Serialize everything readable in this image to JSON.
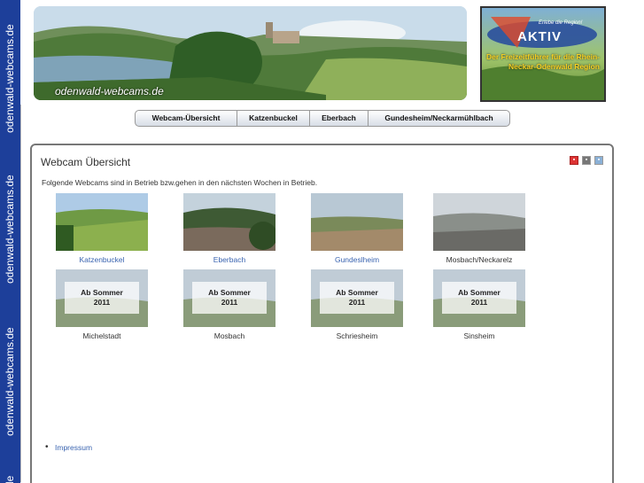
{
  "sidebar": {
    "text": "odenwald-webcams.de",
    "short": "de"
  },
  "banner": {
    "caption": "odenwald-webcams.de"
  },
  "ad": {
    "tagline": "Erlebe die Region!",
    "word": "AKTIV",
    "text": "Der Freizeitführer für die Rhein-Neckar-Odenwald Region"
  },
  "nav": [
    "Webcam-Übersicht",
    "Katzenbuckel",
    "Eberbach",
    "Gundesheim/Neckarmühlbach"
  ],
  "page": {
    "title": "Webcam Übersicht",
    "intro": "Folgende Webcams sind in Betrieb bzw.gehen in den nächsten Wochen in Betrieb.",
    "icons": [
      "pdf-icon",
      "print-icon",
      "email-icon"
    ]
  },
  "cams": [
    {
      "label": "Katzenbuckel",
      "link": true,
      "soon": ""
    },
    {
      "label": "Eberbach",
      "link": true,
      "soon": ""
    },
    {
      "label": "Gundeslheim",
      "link": true,
      "soon": ""
    },
    {
      "label": "Mosbach/Neckarelz",
      "link": false,
      "soon": ""
    },
    {
      "label": "Michelstadt",
      "link": false,
      "soon": "Ab Sommer 2011"
    },
    {
      "label": "Mosbach",
      "link": false,
      "soon": "Ab Sommer 2011"
    },
    {
      "label": "Schriesheim",
      "link": false,
      "soon": "Ab Sommer 2011"
    },
    {
      "label": "Sinsheim",
      "link": false,
      "soon": "Ab Sommer 2011"
    }
  ],
  "footer": {
    "impressum": "Impressum"
  },
  "colors": {
    "sidebar": "#1d3f9a",
    "link": "#3a64b0"
  }
}
